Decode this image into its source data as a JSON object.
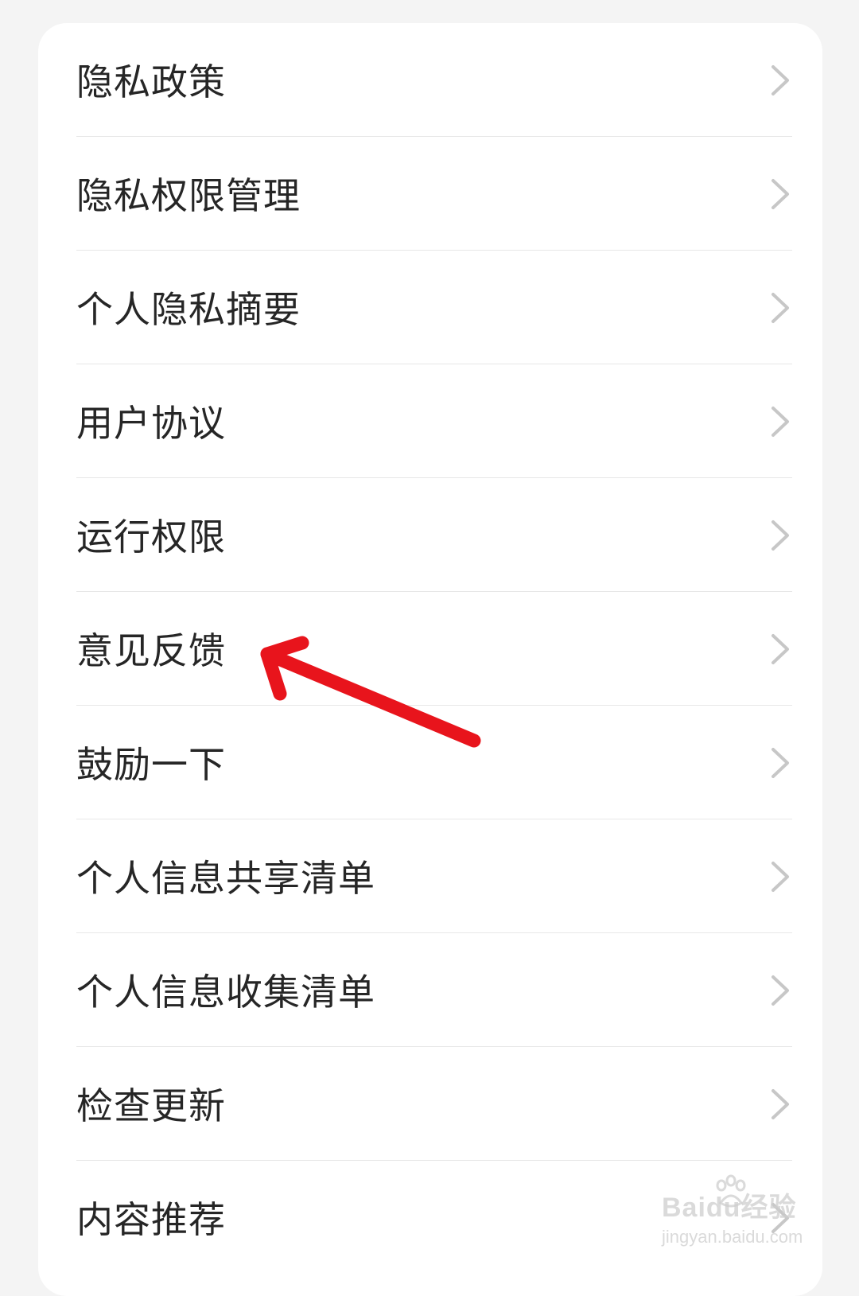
{
  "settings": {
    "items": [
      {
        "label": "隐私政策"
      },
      {
        "label": "隐私权限管理"
      },
      {
        "label": "个人隐私摘要"
      },
      {
        "label": "用户协议"
      },
      {
        "label": "运行权限"
      },
      {
        "label": "意见反馈"
      },
      {
        "label": "鼓励一下"
      },
      {
        "label": "个人信息共享清单"
      },
      {
        "label": "个人信息收集清单"
      },
      {
        "label": "检查更新"
      },
      {
        "label": "内容推荐"
      }
    ]
  },
  "annotation": {
    "type": "arrow",
    "color": "#e8141c",
    "points_to": "意见反馈"
  },
  "watermark": {
    "brand": "Baidu经验",
    "url": "jingyan.baidu.com"
  },
  "icons": {
    "row_chevron": "chevron-right-icon",
    "watermark_logo": "paw-icon"
  }
}
